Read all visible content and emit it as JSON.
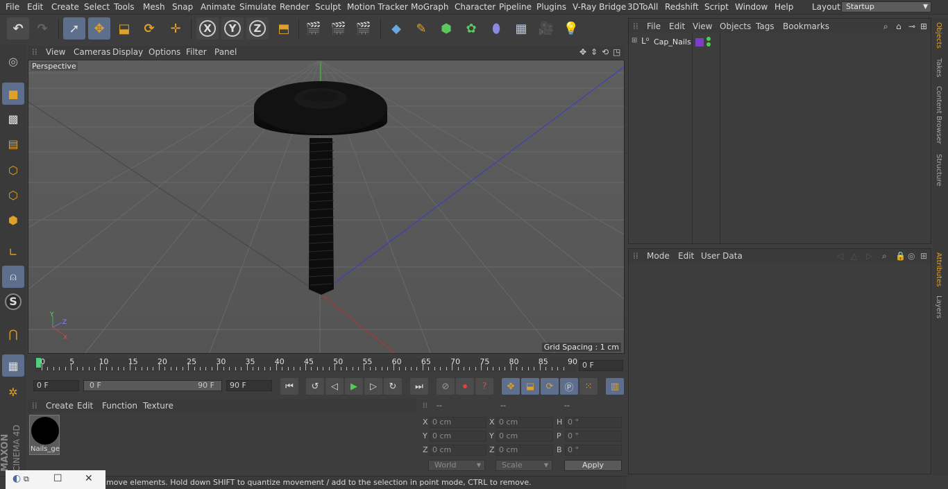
{
  "menubar": {
    "items": [
      "File",
      "Edit",
      "Create",
      "Select",
      "Tools",
      "Mesh",
      "Snap",
      "Animate",
      "Simulate",
      "Render",
      "Sculpt",
      "Motion Tracker",
      "MoGraph",
      "Character",
      "Pipeline",
      "Plugins",
      "V-Ray Bridge",
      "3DToAll",
      "Redshift",
      "Script",
      "Window",
      "Help"
    ],
    "layout_label": "Layout:",
    "layout_value": "Startup"
  },
  "toolbar": {
    "axis_x": "X",
    "axis_y": "Y",
    "axis_z": "Z"
  },
  "viewport": {
    "menu": [
      "View",
      "Cameras",
      "Display",
      "Options",
      "Filter",
      "Panel"
    ],
    "label": "Perspective",
    "grid_spacing": "Grid Spacing : 1 cm",
    "axis_labels": {
      "x": "X",
      "y": "Y",
      "z": "Z"
    }
  },
  "timeline": {
    "ticks": [
      "0",
      "5",
      "10",
      "15",
      "20",
      "25",
      "30",
      "35",
      "40",
      "45",
      "50",
      "55",
      "60",
      "65",
      "70",
      "75",
      "80",
      "85",
      "90"
    ],
    "current_frame": "0 F"
  },
  "transport": {
    "start_frame": "0 F",
    "range_start": "0 F",
    "range_end": "90 F",
    "end_frame": "90 F"
  },
  "materials": {
    "menu": [
      "Create",
      "Edit",
      "Function",
      "Texture"
    ],
    "items": [
      {
        "name": "Nails_ge"
      }
    ]
  },
  "coordinates": {
    "headers": [
      "--",
      "--",
      "--"
    ],
    "rows": [
      {
        "l1": "X",
        "v1": "0 cm",
        "l2": "X",
        "v2": "0 cm",
        "l3": "H",
        "v3": "0 °"
      },
      {
        "l1": "Y",
        "v1": "0 cm",
        "l2": "Y",
        "v2": "0 cm",
        "l3": "P",
        "v3": "0 °"
      },
      {
        "l1": "Z",
        "v1": "0 cm",
        "l2": "Z",
        "v2": "0 cm",
        "l3": "B",
        "v3": "0 °"
      }
    ],
    "space": "World",
    "mode": "Scale",
    "apply": "Apply"
  },
  "status": {
    "text": "move elements. Hold down SHIFT to quantize movement / add to the selection in point mode, CTRL to remove."
  },
  "branding": {
    "line1": "MAXON",
    "line2": "CINEMA 4D"
  },
  "objects": {
    "menu": [
      "File",
      "Edit",
      "View",
      "Objects",
      "Tags",
      "Bookmarks"
    ],
    "items": [
      {
        "name": "Cap_Nails"
      }
    ]
  },
  "attributes": {
    "menu": [
      "Mode",
      "Edit",
      "User Data"
    ]
  },
  "right_tabs": [
    "Objects",
    "Takes",
    "Content Browser",
    "Structure",
    "Attributes",
    "Layers"
  ]
}
